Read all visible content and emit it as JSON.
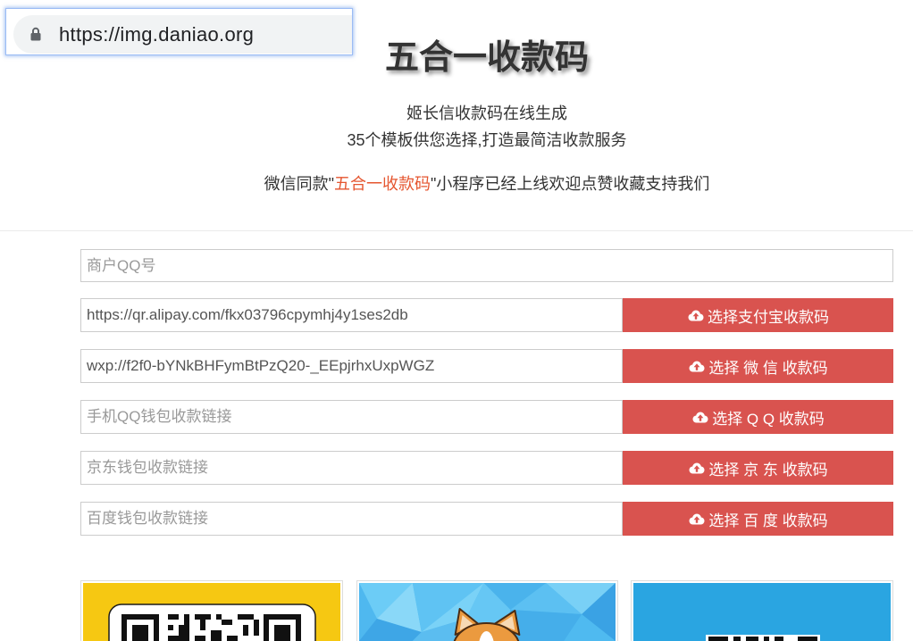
{
  "browser": {
    "url": "https://img.daniao.org",
    "lock_icon": "lock-icon"
  },
  "header": {
    "title": "五合一收款码",
    "subtitle_line1": "姬长信收款码在线生成",
    "subtitle_line2": "35个模板供您选择,打造最简洁收款服务",
    "notice": {
      "before": "微信同款\"",
      "highlight": "五合一收款码",
      "after": "\"小程序已经上线欢迎点赞收藏支持我们"
    }
  },
  "form": {
    "merchant_qq": {
      "placeholder": "商户QQ号"
    },
    "payment_rows": [
      {
        "value": "https://qr.alipay.com/fkx03796cpymhj4y1ses2db",
        "button_label": "选择支付宝收款码",
        "button_icon": "cloud-upload-icon"
      },
      {
        "value": "wxp://f2f0-bYNkBHFymBtPzQ20-_EEpjrhxUxpWGZ",
        "button_label": "选择 微 信 收款码",
        "button_icon": "cloud-upload-icon"
      },
      {
        "placeholder": "手机QQ钱包收款链接",
        "button_label": "选择 Q Q 收款码",
        "button_icon": "cloud-upload-icon"
      },
      {
        "placeholder": "京东钱包收款链接",
        "button_label": "选择 京 东 收款码",
        "button_icon": "cloud-upload-icon"
      },
      {
        "placeholder": "百度钱包收款链接",
        "button_label": "选择 百 度 收款码",
        "button_icon": "cloud-upload-icon"
      }
    ]
  },
  "templates": [
    {
      "background": "#f6c812"
    },
    {
      "background": "#4fbaf0"
    },
    {
      "background": "#2aa5e1"
    }
  ],
  "colors": {
    "button": "#d9534f",
    "highlight": "#e5552f",
    "text": "#333333",
    "url_bar": "#f1f3f4"
  }
}
